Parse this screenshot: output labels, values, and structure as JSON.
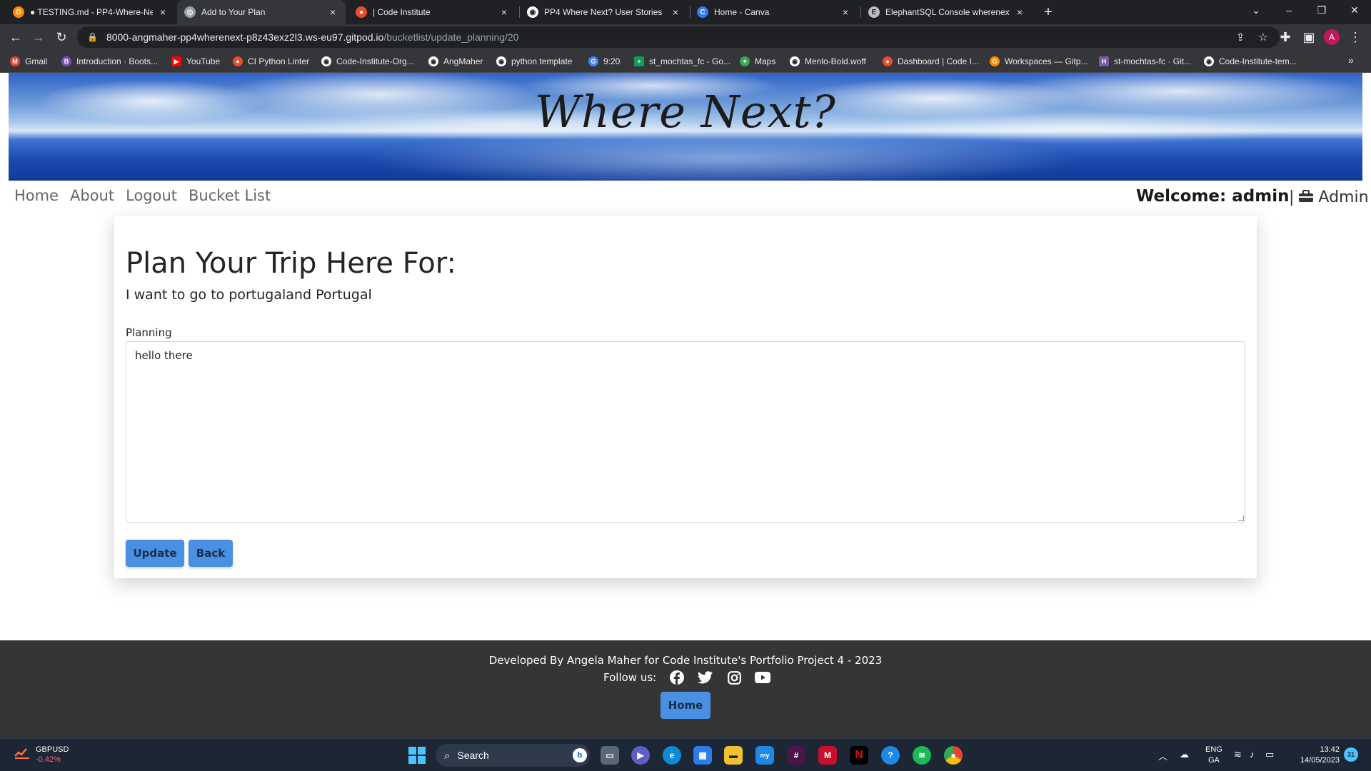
{
  "browser": {
    "tabs": [
      {
        "title": "● TESTING.md - PP4-Where-Nex",
        "icon": "gitpod-icon",
        "color": "#ff8a00"
      },
      {
        "title": "Add to Your Plan",
        "icon": "globe-icon",
        "color": "#9aa0a6",
        "active": true
      },
      {
        "title": "| Code Institute",
        "icon": "code-institute-icon",
        "color": "#ea4c2c"
      },
      {
        "title": "PP4 Where Next? User Stories",
        "icon": "github-icon",
        "color": "#ffffff"
      },
      {
        "title": "Home - Canva",
        "icon": "canva-icon",
        "color": "#2d7cf6"
      },
      {
        "title": "ElephantSQL Console wherenext",
        "icon": "elephant-icon",
        "color": "#bdbdbd"
      }
    ],
    "url_host": "8000-angmaher-pp4wherenext-p8z43exz2l3.ws-eu97.gitpod.io",
    "url_path": "/bucketlist/update_planning/20",
    "profile_initial": "A",
    "bookmarks": [
      {
        "label": "Gmail",
        "icon": "gmail-icon",
        "color": "#ea4335"
      },
      {
        "label": "Introduction · Boots...",
        "icon": "bootstrap-icon",
        "color": "#7952b3"
      },
      {
        "label": "YouTube",
        "icon": "youtube-icon",
        "color": "#ff0000"
      },
      {
        "label": "CI Python Linter",
        "icon": "code-institute-icon",
        "color": "#ea4c2c"
      },
      {
        "label": "Code-Institute-Org...",
        "icon": "github-icon",
        "color": "#ffffff"
      },
      {
        "label": "AngMaher",
        "icon": "github-icon",
        "color": "#ffffff"
      },
      {
        "label": "python template",
        "icon": "github-icon",
        "color": "#ffffff"
      },
      {
        "label": "9:20",
        "icon": "google-icon",
        "color": "#4285f4"
      },
      {
        "label": "st_mochtas_fc - Go...",
        "icon": "sheets-icon",
        "color": "#0f9d58"
      },
      {
        "label": "Maps",
        "icon": "maps-icon",
        "color": "#34a853"
      },
      {
        "label": "Menlo-Bold.woff",
        "icon": "github-icon",
        "color": "#ffffff"
      },
      {
        "label": "Dashboard | Code I...",
        "icon": "code-institute-icon",
        "color": "#ea4c2c"
      },
      {
        "label": "Workspaces — Gitp...",
        "icon": "gitpod-icon",
        "color": "#ff8a00"
      },
      {
        "label": "st-mochtas-fc · Git...",
        "icon": "heroku-icon",
        "color": "#79589f"
      },
      {
        "label": "Code-Institute-tem...",
        "icon": "github-icon",
        "color": "#ffffff"
      }
    ]
  },
  "site": {
    "brand": "Where Next?",
    "nav": [
      "Home",
      "About",
      "Logout",
      "Bucket List"
    ],
    "welcome": "Welcome: admin",
    "admin_link": "Admin",
    "heading": "Plan Your Trip Here For:",
    "subheading": "I want to go to portugaland Portugal",
    "planning_label": "Planning",
    "planning_value": "hello there",
    "update_label": "Update",
    "back_label": "Back",
    "footer_credit": "Developed By Angela Maher for Code Institute's Portfolio Project 4 - 2023",
    "follow_label": "Follow us:",
    "footer_home_label": "Home",
    "accent": "#4a90e2"
  },
  "taskbar": {
    "ticker_name": "GBPUSD",
    "ticker_value": "-0.42%",
    "search_placeholder": "Search",
    "lang_line1": "ENG",
    "lang_line2": "GA",
    "time": "13:42",
    "date": "14/05/2023",
    "notifications": "31"
  }
}
